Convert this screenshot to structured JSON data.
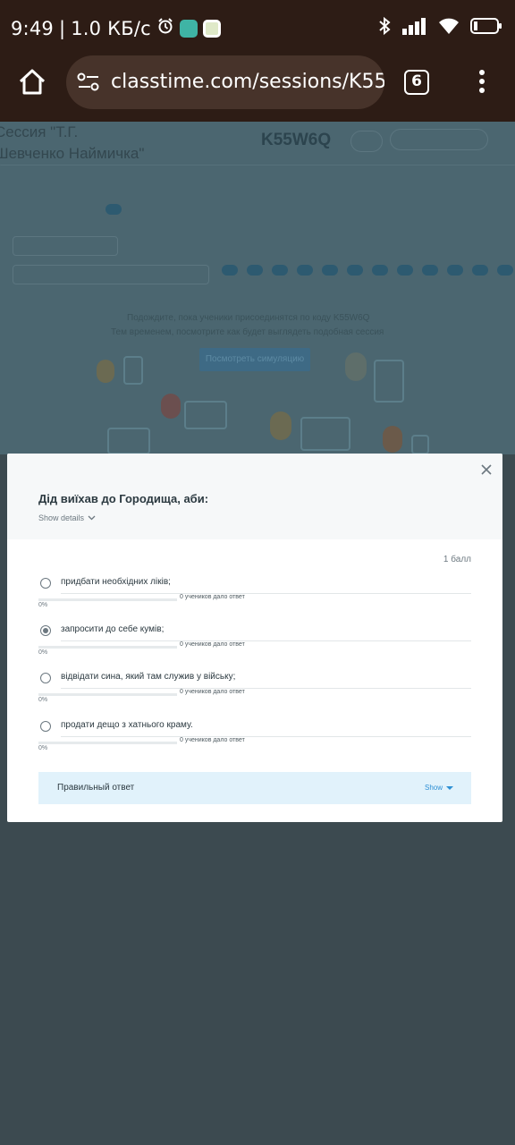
{
  "status_bar": {
    "time": "9:49",
    "speed": "1.0 КБ/с",
    "battery": "12",
    "icons": [
      "alarm-icon",
      "app-icon",
      "app-icon-2",
      "bluetooth-icon",
      "signal-icon",
      "wifi-icon",
      "battery-icon"
    ]
  },
  "browser": {
    "url": "classtime.com/sessions/K55W6Q",
    "tab_count": "6"
  },
  "background_page": {
    "session_title": "Сессия \"Т.Г. Шевченко Наймичка\"",
    "session_code": "K55W6Q",
    "waiting_text": "Подождите, пока ученики присоединятся по коду K55W6Q",
    "waiting_text_2": "Тем временем, посмотрите как будет выглядеть подобная сессия",
    "simulation_button": "Посмотреть симуляцию",
    "question_numbers": [
      "1",
      "2",
      "3",
      "4",
      "5",
      "6",
      "7",
      "8",
      "9",
      "10",
      "11",
      "12"
    ]
  },
  "modal": {
    "question_title": "Дід виїхав до Городища, аби:",
    "show_details": "Show details",
    "points": "1 балл",
    "options": [
      {
        "label": "придбати необхідних ліків;",
        "count_text": "0 учеников дало ответ",
        "percent": "0%",
        "fraction": 0,
        "selected": false
      },
      {
        "label": "запросити до себе кумів;",
        "count_text": "0 учеников дало ответ",
        "percent": "0%",
        "fraction": 0,
        "selected": true
      },
      {
        "label": "відвідати сина, який там служив у війську;",
        "count_text": "0 учеников дало ответ",
        "percent": "0%",
        "fraction": 0,
        "selected": false
      },
      {
        "label": "продати дещо з хатнього краму.",
        "count_text": "0 учеников дало ответ",
        "percent": "0%",
        "fraction": 0,
        "selected": false
      }
    ],
    "correct_answer_label": "Правильный ответ",
    "correct_answer_toggle": "Show"
  },
  "colors": {
    "accent": "#2d8fd4",
    "overlay": "#3c4a50",
    "browser_bar": "#2d1c15"
  }
}
